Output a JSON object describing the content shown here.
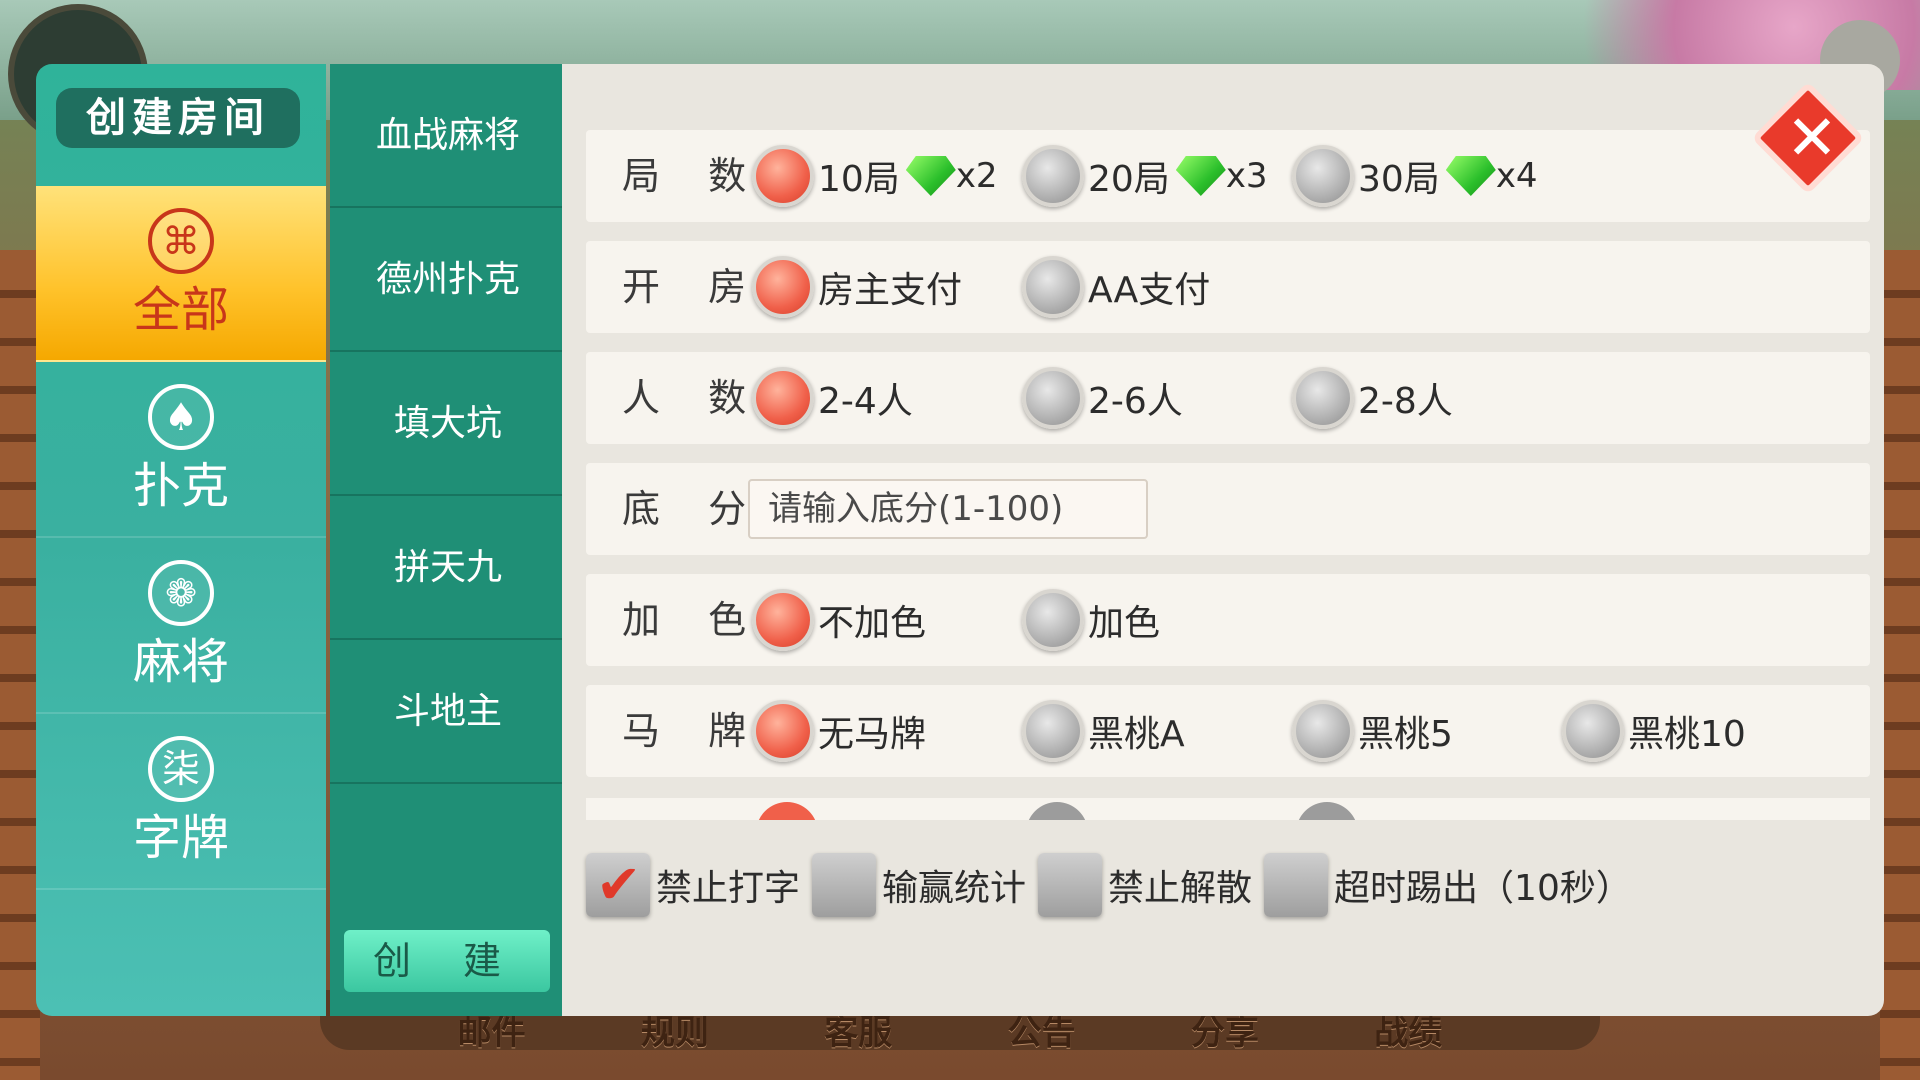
{
  "dialog": {
    "title": "创建房间"
  },
  "categories": [
    {
      "label": "全部",
      "icon": "gamepad-icon",
      "active": true
    },
    {
      "label": "扑克",
      "icon": "spade-icon",
      "active": false
    },
    {
      "label": "麻将",
      "icon": "mahjong-tile-icon",
      "active": false
    },
    {
      "label": "字牌",
      "icon": "character-tile-icon",
      "active": false
    }
  ],
  "games": [
    "血战麻将",
    "德州扑克",
    "填大坑",
    "拼天九",
    "斗地主"
  ],
  "create_button": "创 建",
  "options": {
    "rounds": {
      "label": "局 数:",
      "choices": [
        {
          "text": "10局",
          "mult": "x2",
          "selected": true
        },
        {
          "text": "20局",
          "mult": "x3",
          "selected": false
        },
        {
          "text": "30局",
          "mult": "x4",
          "selected": false
        }
      ]
    },
    "pay": {
      "label": "开 房:",
      "choices": [
        {
          "text": "房主支付",
          "selected": true
        },
        {
          "text": "AA支付",
          "selected": false
        }
      ]
    },
    "players": {
      "label": "人 数:",
      "choices": [
        {
          "text": "2-4人",
          "selected": true
        },
        {
          "text": "2-6人",
          "selected": false
        },
        {
          "text": "2-8人",
          "selected": false
        }
      ]
    },
    "base_score": {
      "label": "底 分:",
      "placeholder": "请输入底分(1-100)"
    },
    "color": {
      "label": "加 色:",
      "choices": [
        {
          "text": "不加色",
          "selected": true
        },
        {
          "text": "加色",
          "selected": false
        }
      ]
    },
    "horse": {
      "label": "马 牌:",
      "choices": [
        {
          "text": "无马牌",
          "selected": true
        },
        {
          "text": "黑桃A",
          "selected": false
        },
        {
          "text": "黑桃5",
          "selected": false
        },
        {
          "text": "黑桃10",
          "selected": false
        }
      ]
    }
  },
  "checkboxes": [
    {
      "text": "禁止打字",
      "checked": true
    },
    {
      "text": "输赢统计",
      "checked": false
    },
    {
      "text": "禁止解散",
      "checked": false
    },
    {
      "text": "超时踢出（10秒）",
      "checked": false
    }
  ],
  "bottom_nav": [
    "邮件",
    "规则",
    "客服",
    "公告",
    "分享",
    "战绩"
  ],
  "colors": {
    "accent_red": "#f0604a",
    "panel_green": "#1f8f76",
    "active_yellow": "#ffc22a"
  }
}
